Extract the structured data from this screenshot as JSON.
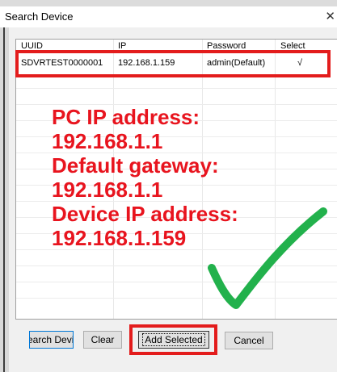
{
  "window": {
    "title": "Search Device",
    "close_glyph": "✕"
  },
  "table": {
    "columns": [
      "UUID",
      "IP",
      "Password",
      "Select"
    ],
    "rows": [
      {
        "uuid": "SDVRTEST0000001",
        "ip": "192.168.1.159",
        "password": "admin(Default)",
        "select": "√"
      }
    ]
  },
  "annotation": {
    "lines": [
      "PC IP address:",
      "192.168.1.1",
      "Default gateway:",
      "192.168.1.1",
      "Device IP address:",
      "192.168.1.159"
    ],
    "color": "#e8141e",
    "highlight_color": "#e31c1c",
    "check_color": "#22b14c",
    "check_icon": "green-checkmark"
  },
  "buttons": {
    "search": "earch Devic",
    "clear": "Clear",
    "add_selected": "Add Selected",
    "cancel": "Cancel"
  }
}
